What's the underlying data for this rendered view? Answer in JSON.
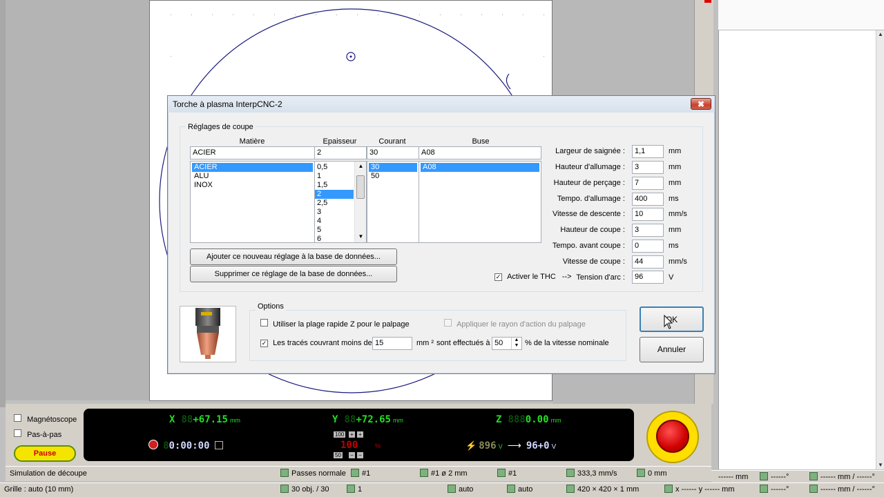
{
  "dialog": {
    "title": "Torche à plasma InterpCNC-2",
    "close_glyph": "✖",
    "cut_settings": {
      "group_label": "Réglages de coupe",
      "headers": {
        "material": "Matière",
        "thickness": "Epaisseur",
        "current": "Courant",
        "nozzle": "Buse"
      },
      "values": {
        "material": "ACIER",
        "thickness": "2",
        "current": "30",
        "nozzle": "A08"
      },
      "material_list": [
        "ACIER",
        "ALU",
        "INOX"
      ],
      "thickness_list": [
        "0,5",
        "1",
        "1,5",
        "2",
        "2,5",
        "3",
        "4",
        "5",
        "6"
      ],
      "current_list": [
        "30",
        "50"
      ],
      "nozzle_list": [
        "A08"
      ],
      "add_button": "Ajouter ce nouveau réglage à la base de données...",
      "delete_button": "Supprimer ce réglage de la base de données...",
      "params": [
        {
          "label": "Largeur de saignée :",
          "value": "1,1",
          "unit": "mm"
        },
        {
          "label": "Hauteur d'allumage :",
          "value": "3",
          "unit": "mm"
        },
        {
          "label": "Hauteur de perçage :",
          "value": "7",
          "unit": "mm"
        },
        {
          "label": "Tempo. d'allumage :",
          "value": "400",
          "unit": "ms"
        },
        {
          "label": "Vitesse de descente :",
          "value": "10",
          "unit": "mm/s"
        },
        {
          "label": "Hauteur de coupe :",
          "value": "3",
          "unit": "mm"
        },
        {
          "label": "Tempo. avant coupe :",
          "value": "0",
          "unit": "ms"
        },
        {
          "label": "Vitesse de coupe :",
          "value": "44",
          "unit": "mm/s"
        }
      ],
      "thc_label": "Activer le THC",
      "thc_arrow": "-->",
      "arc_voltage_label": "Tension d'arc :",
      "arc_voltage_value": "96",
      "arc_voltage_unit": "V"
    },
    "options": {
      "group_label": "Options",
      "fast_z_label": "Utiliser la plage rapide Z pour le palpage",
      "probe_radius_label": "Appliquer le rayon d'action du palpage",
      "small_paths_label": "Les tracés couvrant moins de",
      "small_paths_area": "15",
      "area_unit": "mm ²",
      "speed_text": "sont effectués à",
      "speed_percent": "50",
      "speed_suffix": "% de la vitesse nominale"
    },
    "ok_button": "OK",
    "cancel_button": "Annuler"
  },
  "controls": {
    "magnetoscope_label": "Magnétoscope",
    "step_label": "Pas-à-pas",
    "pause_label": "Pause"
  },
  "dro": {
    "x_label": "X",
    "x_dim": "88",
    "x_value": "+67.15",
    "x_unit": "mm",
    "y_label": "Y",
    "y_dim": "88",
    "y_value": "+72.65",
    "y_unit": "mm",
    "z_label": "Z",
    "z_dim": "888",
    "z_value": "0.00",
    "z_unit": "mm",
    "time_value": "0:00:00",
    "feed_override": "100",
    "feed_value": "100",
    "feed_unit": "%",
    "rapid_override": "50",
    "voltage_measured": "896",
    "voltage_unit": "V",
    "voltage_target": "96+0",
    "voltage_target_unit": "V"
  },
  "status_bar_1": {
    "mode": "Simulation de découpe",
    "passes": "Passes normale",
    "pass_num": "#1",
    "tool": "#1  ø 2 mm",
    "grid_num": "#1",
    "speed": "333,3 mm/s",
    "offset": "0 mm"
  },
  "status_bar_2": {
    "grid": "Grille : auto  (10 mm)",
    "objects": "30 obj. / 30",
    "count": "1",
    "auto1": "auto",
    "auto2": "auto",
    "size": "420 × 420 × 1 mm",
    "coords": "x ------  y ------  mm"
  },
  "right_status": {
    "row1_a": "------ mm",
    "row1_b": "------°",
    "row1_c": "------ mm / ------°",
    "row2_b": "------°",
    "row2_c": "------ mm / ------°"
  },
  "colors": {
    "selection": "#3399ff",
    "dro_green": "#21e021",
    "pause_yellow": "#f4e400",
    "estop_red": "#d00000"
  }
}
